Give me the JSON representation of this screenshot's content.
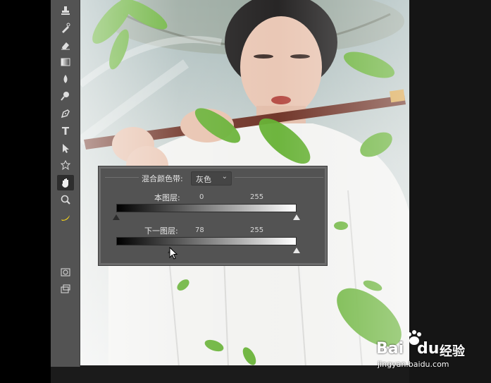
{
  "blend_panel": {
    "blend_color_band_label": "混合颜色带:",
    "blend_color_band_value": "灰色",
    "this_layer_label": "本图层:",
    "this_layer_black": "0",
    "this_layer_white": "255",
    "underlying_layer_label": "下一图层:",
    "underlying_layer_black": "78",
    "underlying_layer_white": "255",
    "this_layer_black_level": 0,
    "this_layer_white_level": 255,
    "underlying_layer_black_level": 78,
    "underlying_layer_white_level": 255
  },
  "tools": [
    {
      "name": "clone-stamp-icon"
    },
    {
      "name": "history-brush-icon"
    },
    {
      "name": "eraser-icon"
    },
    {
      "name": "gradient-icon"
    },
    {
      "name": "blur-icon"
    },
    {
      "name": "dodge-icon"
    },
    {
      "name": "pen-icon"
    },
    {
      "name": "type-icon",
      "glyph": "T"
    },
    {
      "name": "path-selection-icon"
    },
    {
      "name": "custom-shape-icon"
    },
    {
      "name": "hand-icon"
    },
    {
      "name": "zoom-icon"
    },
    {
      "name": "banana-icon"
    },
    {
      "name": "quick-mask-icon"
    },
    {
      "name": "screen-mode-icon"
    }
  ],
  "colors": {
    "foreground": "#ff0000",
    "background": "#6b2a0a",
    "panel": "#535353"
  },
  "watermark": {
    "brand_latin": "Bai",
    "brand_du": "du",
    "brand_cn": "经验",
    "url": "jingyan.baidu.com"
  }
}
